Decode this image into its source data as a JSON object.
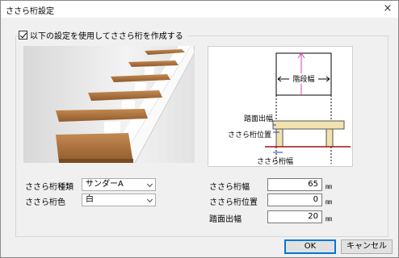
{
  "window": {
    "title": "ささら桁設定",
    "close_glyph": "×"
  },
  "checkbox": {
    "label": "以下の設定を使用してささら桁を作成する",
    "checked": true
  },
  "diagram": {
    "width_label": "階段幅",
    "tread_overhang_label": "踏面出幅",
    "stringer_pos_label": "ささら桁位置",
    "stringer_width_label": "ささら桁幅"
  },
  "form": {
    "stringer_type": {
      "label": "ささら桁種類",
      "value": "サンダーA"
    },
    "stringer_color": {
      "label": "ささら桁色",
      "value": "白"
    },
    "stringer_width": {
      "label": "ささら桁幅",
      "value": "65",
      "unit": "㎜"
    },
    "stringer_position": {
      "label": "ささら桁位置",
      "value": "0",
      "unit": "㎜"
    },
    "tread_overhang": {
      "label": "踏面出幅",
      "value": "20",
      "unit": "㎜"
    }
  },
  "buttons": {
    "ok": "OK",
    "cancel": "キャンセル"
  },
  "colors": {
    "accent": "#0078d7",
    "wood": "#b07a45",
    "arrow": "#e040c0",
    "diagram_line": "#1a3fd6",
    "floor_line": "#a01010"
  }
}
